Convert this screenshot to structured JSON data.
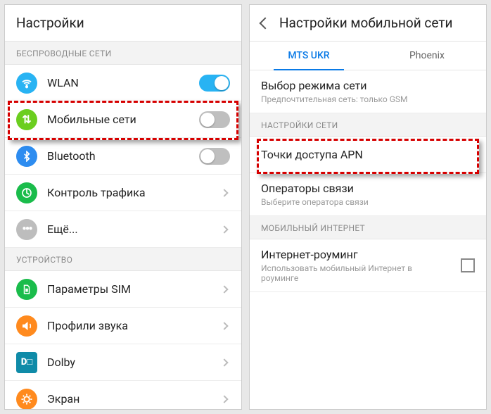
{
  "left": {
    "title": "Настройки",
    "wireless_section": "БЕСПРОВОДНЫЕ СЕТИ",
    "wlan": "WLAN",
    "mobile": "Мобильные сети",
    "bluetooth": "Bluetooth",
    "traffic": "Контроль трафика",
    "more": "Ещё...",
    "device_section": "УСТРОЙСТВО",
    "sim": "Параметры SIM",
    "sound": "Профили звука",
    "dolby": "Dolby",
    "screen": "Экран"
  },
  "right": {
    "title": "Настройки мобильной сети",
    "tab1": "MTS UKR",
    "tab2": "Phoenix",
    "mode_title": "Выбор режима сети",
    "mode_sub": "Предпочтительная сеть: только GSM",
    "net_section": "НАСТРОЙКИ СЕТИ",
    "apn": "Точки доступа APN",
    "operators_title": "Операторы связи",
    "operators_sub": "Выберите оператора связи",
    "internet_section": "МОБИЛЬНЫЙ ИНТЕРНЕТ",
    "roaming_title": "Интернет-роуминг",
    "roaming_sub": "Использовать мобильный Интернет в роуминге"
  }
}
